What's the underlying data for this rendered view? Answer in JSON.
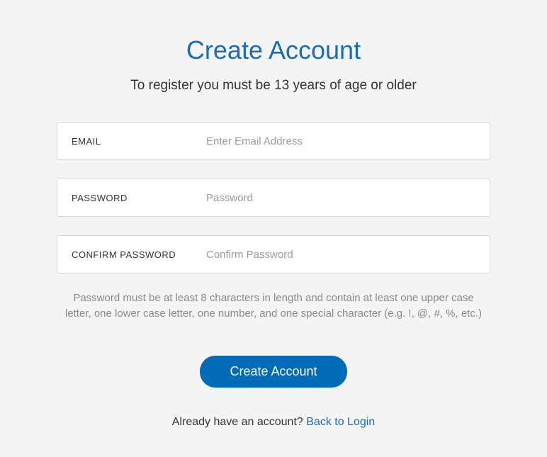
{
  "header": {
    "title": "Create Account",
    "subtitle": "To register you must be 13 years of age or older"
  },
  "fields": {
    "email": {
      "label": "EMAIL",
      "placeholder": "Enter Email Address",
      "value": ""
    },
    "password": {
      "label": "PASSWORD",
      "placeholder": "Password",
      "value": ""
    },
    "confirm": {
      "label": "CONFIRM PASSWORD",
      "placeholder": "Confirm Password",
      "value": ""
    }
  },
  "hint": "Password must be at least 8 characters in length and contain at least one upper case letter, one lower case letter, one number, and one special character (e.g. !, @, #, %, etc.)",
  "actions": {
    "submit_label": "Create Account"
  },
  "footer": {
    "prompt": "Already have an account? ",
    "link_label": "Back to Login"
  }
}
